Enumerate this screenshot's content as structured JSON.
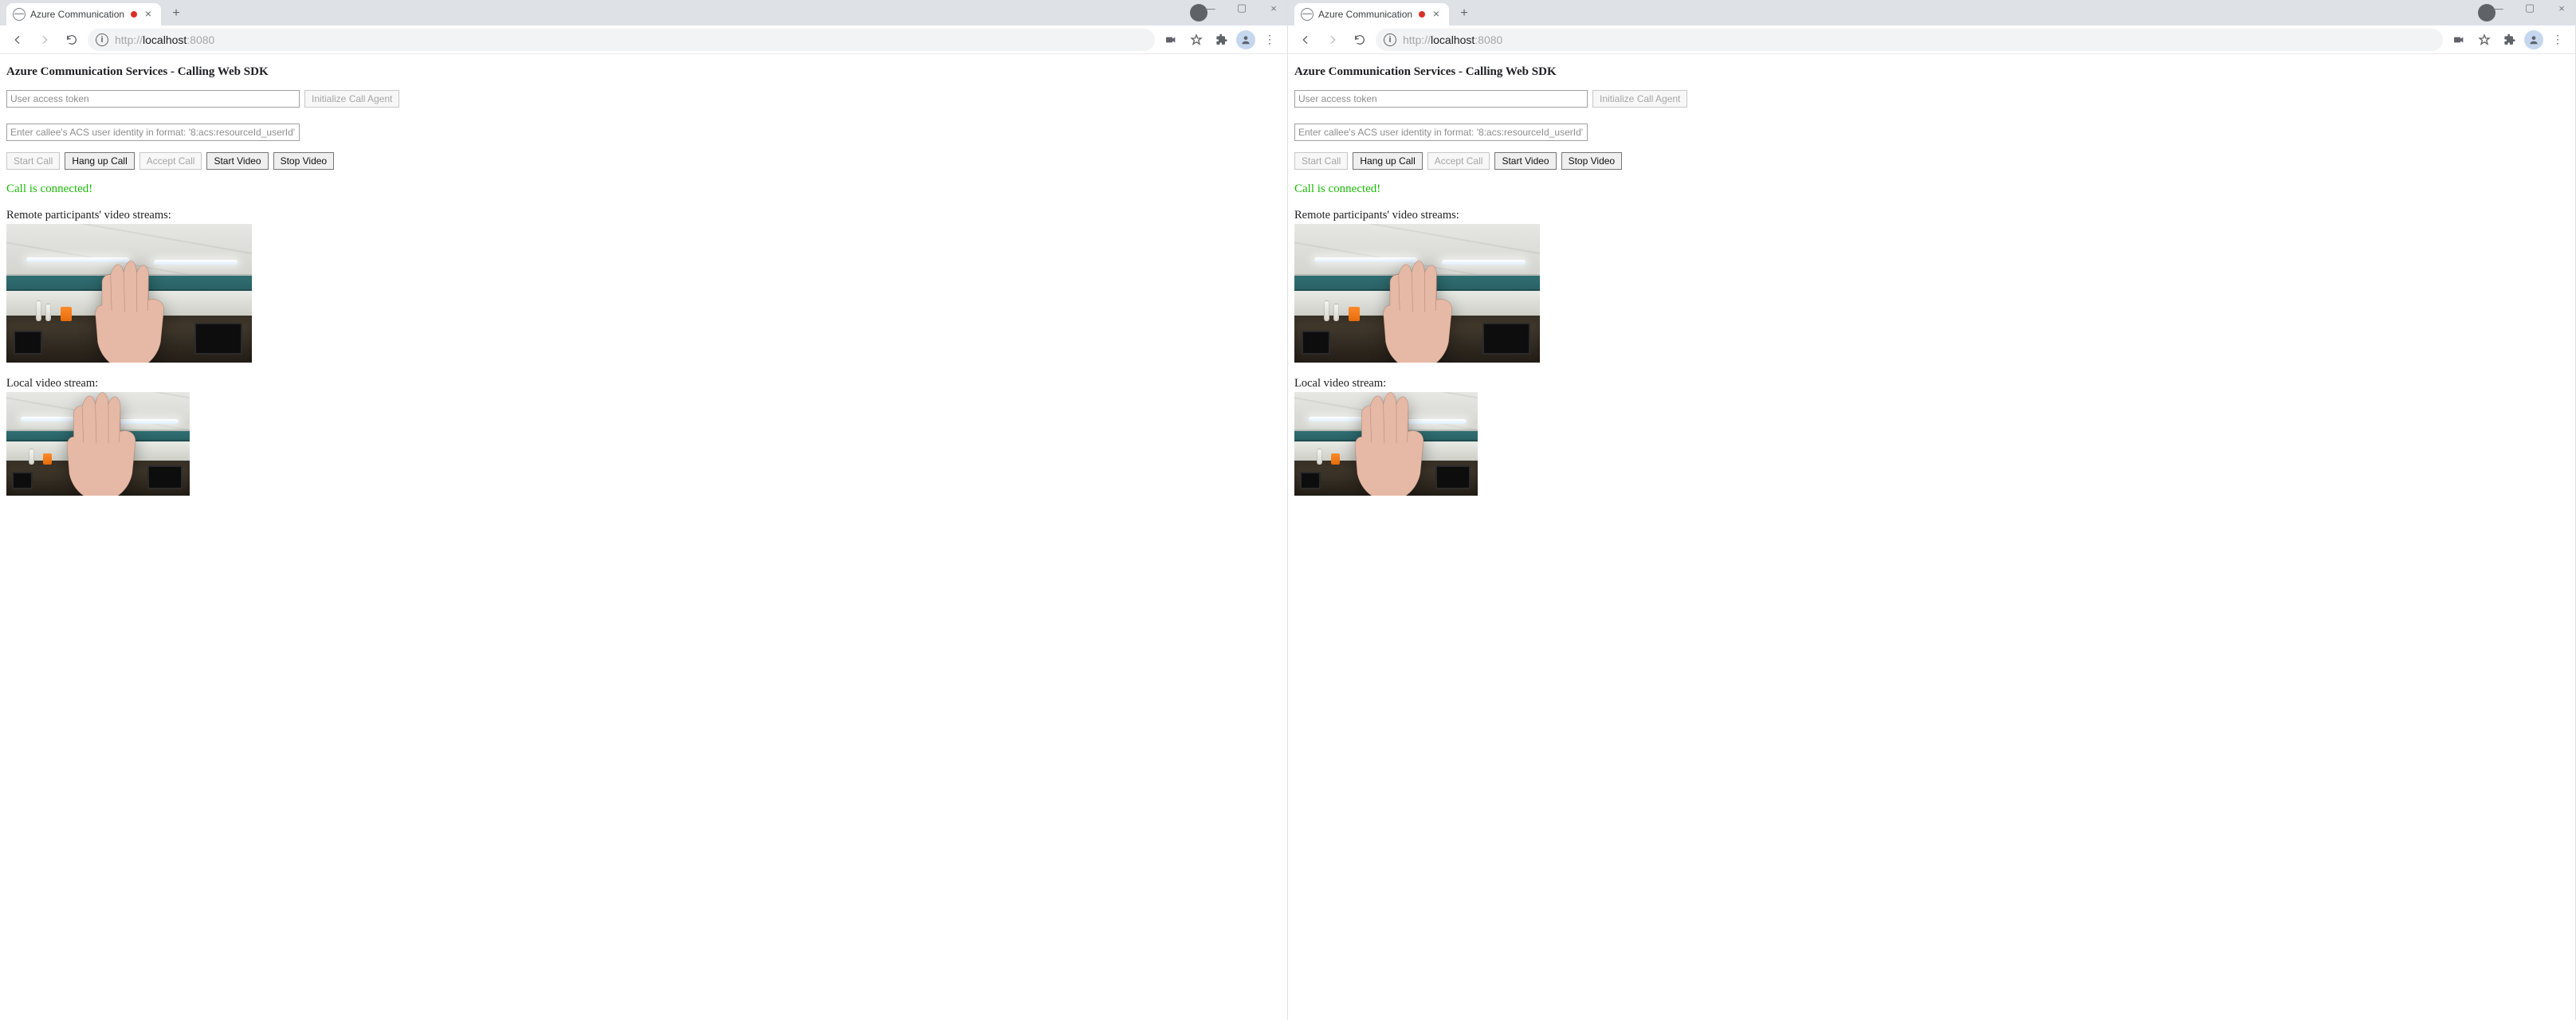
{
  "tab": {
    "title": "Azure Communication Servic",
    "recording": true
  },
  "address_bar": {
    "scheme": "http://",
    "host": "localhost",
    "port": ":8080"
  },
  "page": {
    "heading": "Azure Communication Services - Calling Web SDK",
    "token_placeholder": "User access token",
    "init_button": "Initialize Call Agent",
    "callee_placeholder": "Enter callee's ACS user identity in format: '8:acs:resourceId_userId'",
    "buttons": {
      "start_call": "Start Call",
      "hang_up": "Hang up Call",
      "accept_call": "Accept Call",
      "start_video": "Start Video",
      "stop_video": "Stop Video"
    },
    "status": "Call is connected!",
    "remote_label": "Remote participants' video streams:",
    "local_label": "Local video stream:"
  }
}
